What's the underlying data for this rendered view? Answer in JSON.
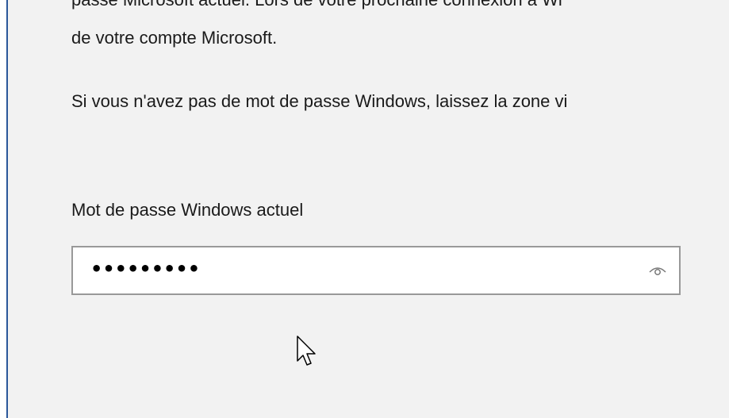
{
  "dialog": {
    "clipped_line": "passe Microsoft actuel. Lors de votre prochaine connexion à Wi",
    "line_2": "de votre compte Microsoft.",
    "line_3": "Si vous n'avez pas de mot de passe Windows, laissez la zone vi",
    "field_label": "Mot de passe Windows actuel",
    "password_value": "•••••••••",
    "reveal_icon": "eye-icon",
    "pointer_icon": "mouse-pointer-icon"
  },
  "colors": {
    "panel_background": "#f2f2f2",
    "accent_border": "#2b579a",
    "input_border": "#999999",
    "text": "#1a1a1a"
  }
}
